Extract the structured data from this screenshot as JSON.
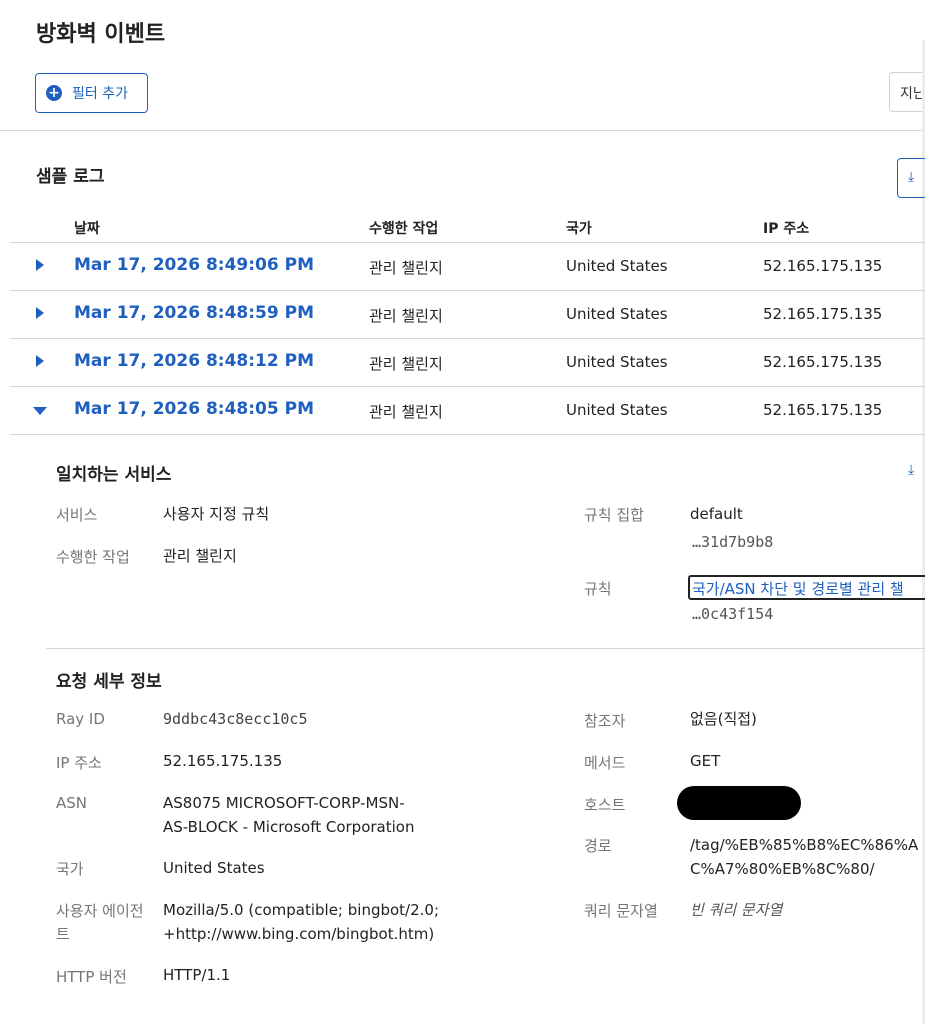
{
  "page": {
    "title": "방화벽 이벤트"
  },
  "toolbar": {
    "filter_button": "필터 추가",
    "time_select": "지난"
  },
  "sample_log": {
    "title": "샘플 로그",
    "columns": {
      "date": "날짜",
      "action": "수행한 작업",
      "country": "국가",
      "ip": "IP 주소"
    },
    "rows": [
      {
        "date": "Mar 17, 2026 8:49:06 PM",
        "action": "관리 챌린지",
        "country": "United States",
        "ip": "52.165.175.135",
        "expanded": false
      },
      {
        "date": "Mar 17, 2026 8:48:59 PM",
        "action": "관리 챌린지",
        "country": "United States",
        "ip": "52.165.175.135",
        "expanded": false
      },
      {
        "date": "Mar 17, 2026 8:48:12 PM",
        "action": "관리 챌린지",
        "country": "United States",
        "ip": "52.165.175.135",
        "expanded": false
      },
      {
        "date": "Mar 17, 2026 8:48:05 PM",
        "action": "관리 챌린지",
        "country": "United States",
        "ip": "52.165.175.135",
        "expanded": true
      }
    ]
  },
  "matched_service": {
    "title": "일치하는 서비스",
    "service_label": "서비스",
    "service_value": "사용자 지정 규칙",
    "action_label": "수행한 작업",
    "action_value": "관리 챌린지",
    "ruleset_label": "규칙 집합",
    "ruleset_value": "default",
    "ruleset_hash": "…31d7b9b8",
    "rule_label": "규칙",
    "rule_value": "국가/ASN 차단 및 경로별 관리 챌",
    "rule_hash": "…0c43f154"
  },
  "request_details": {
    "title": "요청 세부 정보",
    "ray_id_label": "Ray ID",
    "ray_id_value": "9ddbc43c8ecc10c5",
    "ip_label": "IP 주소",
    "ip_value": "52.165.175.135",
    "asn_label": "ASN",
    "asn_value_line1": "AS8075 MICROSOFT-CORP-MSN-",
    "asn_value_line2": "AS-BLOCK - Microsoft Corporation",
    "country_label": "국가",
    "country_value": "United States",
    "ua_label_line1": "사용자 에이전",
    "ua_label_line2": "트",
    "ua_value_line1": "Mozilla/5.0 (compatible; bingbot/2.0;",
    "ua_value_line2": "+http://www.bing.com/bingbot.htm)",
    "http_label": "HTTP 버전",
    "http_value": "HTTP/1.1",
    "referer_label": "참조자",
    "referer_value": "없음(직접)",
    "method_label": "메서드",
    "method_value": "GET",
    "host_label": "호스트",
    "path_label": "경로",
    "path_value_line1": "/tag/%EB%85%B8%EC%86%A",
    "path_value_line2": "C%A7%80%EB%8C%80/",
    "query_label": "쿼리 문자열",
    "query_value": "빈 쿼리 문자열"
  },
  "colors": {
    "link": "#1f5fbf",
    "text": "#222222",
    "muted": "#767676",
    "border": "#d6d6d6"
  }
}
